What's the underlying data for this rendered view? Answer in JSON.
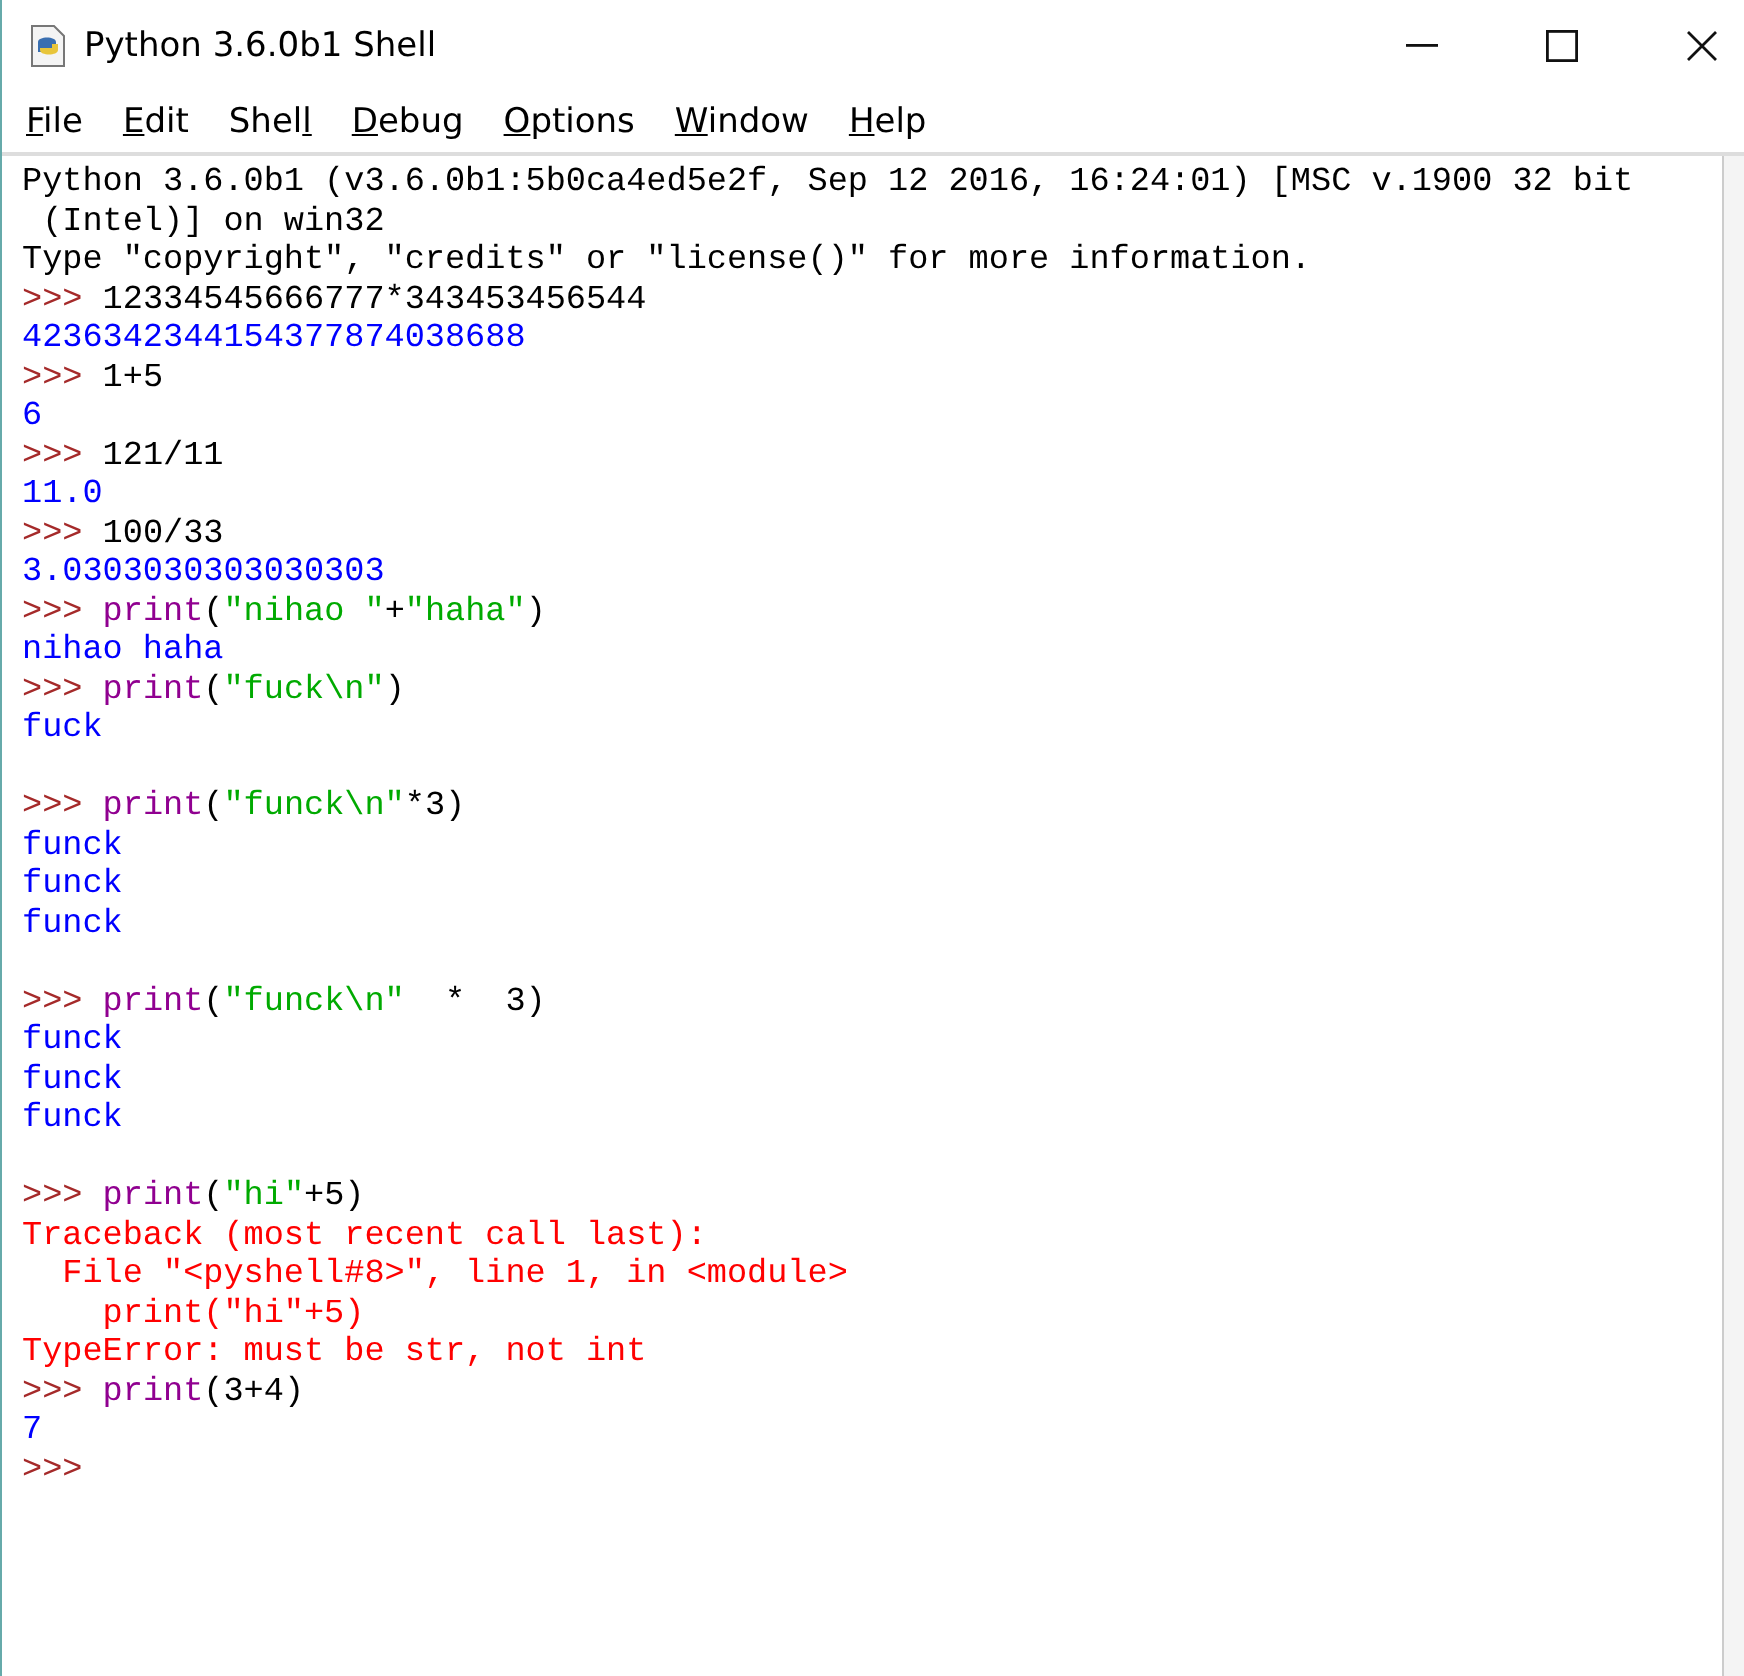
{
  "window": {
    "title": "Python 3.6.0b1 Shell"
  },
  "menu": [
    {
      "parts": [
        {
          "text": "F",
          "underlined": true
        },
        {
          "text": "ile",
          "underlined": false
        }
      ]
    },
    {
      "parts": [
        {
          "text": "E",
          "underlined": true
        },
        {
          "text": "dit",
          "underlined": false
        }
      ]
    },
    {
      "parts": [
        {
          "text": "Shel",
          "underlined": false
        },
        {
          "text": "l",
          "underlined": true
        }
      ]
    },
    {
      "parts": [
        {
          "text": "D",
          "underlined": true
        },
        {
          "text": "ebug",
          "underlined": false
        }
      ]
    },
    {
      "parts": [
        {
          "text": "O",
          "underlined": true
        },
        {
          "text": "ptions",
          "underlined": false
        }
      ]
    },
    {
      "parts": [
        {
          "text": "W",
          "underlined": true
        },
        {
          "text": "indow",
          "underlined": false
        }
      ]
    },
    {
      "parts": [
        {
          "text": "H",
          "underlined": true
        },
        {
          "text": "elp",
          "underlined": false
        }
      ]
    }
  ],
  "console": {
    "lines": [
      {
        "kind": "line",
        "segments": [
          {
            "kind": "info",
            "text": "Python 3.6.0b1 (v3.6.0b1:5b0ca4ed5e2f, Sep 12 2016, 16:24:01) [MSC v.1900 32 bit"
          }
        ]
      },
      {
        "kind": "line",
        "segments": [
          {
            "kind": "info",
            "text": " (Intel)] on win32"
          }
        ]
      },
      {
        "kind": "line",
        "segments": [
          {
            "kind": "info",
            "text": "Type \"copyright\", \"credits\" or \"license()\" for more information."
          }
        ]
      },
      {
        "kind": "line",
        "segments": [
          {
            "kind": "prompt",
            "text": ">>> "
          },
          {
            "kind": "plain",
            "text": "12334545666777*343453456544"
          }
        ]
      },
      {
        "kind": "line",
        "segments": [
          {
            "kind": "output",
            "text": "4236342344154377874038688"
          }
        ]
      },
      {
        "kind": "line",
        "segments": [
          {
            "kind": "prompt",
            "text": ">>> "
          },
          {
            "kind": "plain",
            "text": "1+5"
          }
        ]
      },
      {
        "kind": "line",
        "segments": [
          {
            "kind": "output",
            "text": "6"
          }
        ]
      },
      {
        "kind": "line",
        "segments": [
          {
            "kind": "prompt",
            "text": ">>> "
          },
          {
            "kind": "plain",
            "text": "121/11"
          }
        ]
      },
      {
        "kind": "line",
        "segments": [
          {
            "kind": "output",
            "text": "11.0"
          }
        ]
      },
      {
        "kind": "line",
        "segments": [
          {
            "kind": "prompt",
            "text": ">>> "
          },
          {
            "kind": "plain",
            "text": "100/33"
          }
        ]
      },
      {
        "kind": "line",
        "segments": [
          {
            "kind": "output",
            "text": "3.0303030303030303"
          }
        ]
      },
      {
        "kind": "line",
        "segments": [
          {
            "kind": "prompt",
            "text": ">>> "
          },
          {
            "kind": "builtin",
            "text": "print"
          },
          {
            "kind": "plain",
            "text": "("
          },
          {
            "kind": "string",
            "text": "\"nihao \""
          },
          {
            "kind": "plain",
            "text": "+"
          },
          {
            "kind": "string",
            "text": "\"haha\""
          },
          {
            "kind": "plain",
            "text": ")"
          }
        ]
      },
      {
        "kind": "line",
        "segments": [
          {
            "kind": "output",
            "text": "nihao haha"
          }
        ]
      },
      {
        "kind": "line",
        "segments": [
          {
            "kind": "prompt",
            "text": ">>> "
          },
          {
            "kind": "builtin",
            "text": "print"
          },
          {
            "kind": "plain",
            "text": "("
          },
          {
            "kind": "string",
            "text": "\"fuck\\n\""
          },
          {
            "kind": "plain",
            "text": ")"
          }
        ]
      },
      {
        "kind": "line",
        "segments": [
          {
            "kind": "output",
            "text": "fuck"
          }
        ]
      },
      {
        "kind": "blank"
      },
      {
        "kind": "line",
        "segments": [
          {
            "kind": "prompt",
            "text": ">>> "
          },
          {
            "kind": "builtin",
            "text": "print"
          },
          {
            "kind": "plain",
            "text": "("
          },
          {
            "kind": "string",
            "text": "\"funck\\n\""
          },
          {
            "kind": "plain",
            "text": "*3)"
          }
        ]
      },
      {
        "kind": "line",
        "segments": [
          {
            "kind": "output",
            "text": "funck"
          }
        ]
      },
      {
        "kind": "line",
        "segments": [
          {
            "kind": "output",
            "text": "funck"
          }
        ]
      },
      {
        "kind": "line",
        "segments": [
          {
            "kind": "output",
            "text": "funck"
          }
        ]
      },
      {
        "kind": "blank"
      },
      {
        "kind": "line",
        "segments": [
          {
            "kind": "prompt",
            "text": ">>> "
          },
          {
            "kind": "builtin",
            "text": "print"
          },
          {
            "kind": "plain",
            "text": "("
          },
          {
            "kind": "string",
            "text": "\"funck\\n\""
          },
          {
            "kind": "plain",
            "text": "  *  3)"
          }
        ]
      },
      {
        "kind": "line",
        "segments": [
          {
            "kind": "output",
            "text": "funck"
          }
        ]
      },
      {
        "kind": "line",
        "segments": [
          {
            "kind": "output",
            "text": "funck"
          }
        ]
      },
      {
        "kind": "line",
        "segments": [
          {
            "kind": "output",
            "text": "funck"
          }
        ]
      },
      {
        "kind": "blank"
      },
      {
        "kind": "line",
        "segments": [
          {
            "kind": "prompt",
            "text": ">>> "
          },
          {
            "kind": "builtin",
            "text": "print"
          },
          {
            "kind": "plain",
            "text": "("
          },
          {
            "kind": "string",
            "text": "\"hi\""
          },
          {
            "kind": "plain",
            "text": "+5)"
          }
        ]
      },
      {
        "kind": "line",
        "segments": [
          {
            "kind": "error",
            "text": "Traceback (most recent call last):"
          }
        ]
      },
      {
        "kind": "line",
        "segments": [
          {
            "kind": "error",
            "text": "  File \"<pyshell#8>\", line 1, in <module>"
          }
        ]
      },
      {
        "kind": "line",
        "segments": [
          {
            "kind": "error",
            "text": "    print(\"hi\"+5)"
          }
        ]
      },
      {
        "kind": "line",
        "segments": [
          {
            "kind": "error",
            "text": "TypeError: must be str, not int"
          }
        ]
      },
      {
        "kind": "line",
        "segments": [
          {
            "kind": "prompt",
            "text": ">>> "
          },
          {
            "kind": "builtin",
            "text": "print"
          },
          {
            "kind": "plain",
            "text": "(3+4)"
          }
        ]
      },
      {
        "kind": "line",
        "segments": [
          {
            "kind": "output",
            "text": "7"
          }
        ]
      },
      {
        "kind": "line",
        "segments": [
          {
            "kind": "prompt",
            "text": ">>>"
          }
        ]
      }
    ]
  }
}
